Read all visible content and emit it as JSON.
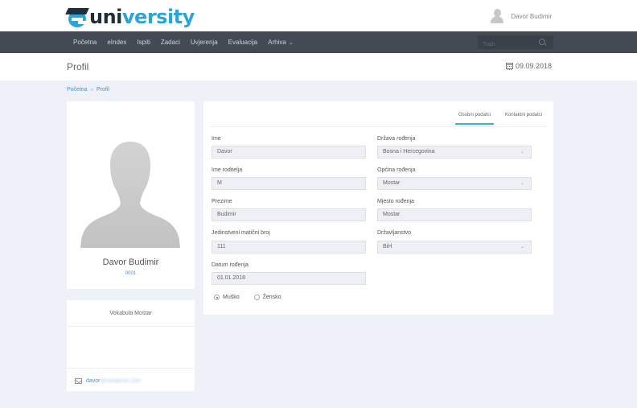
{
  "header": {
    "logo": {
      "part1": "uni",
      "part2": "versity"
    },
    "user_name": "Davor Budimir"
  },
  "nav": {
    "items": [
      "Početna",
      "eIndex",
      "Ispiti",
      "Zadaci",
      "Uvjerenja",
      "Evaluacija",
      "Arhiva"
    ],
    "search_placeholder": "Traži"
  },
  "page": {
    "title": "Profil",
    "date": "09.09.2018"
  },
  "breadcrumb": {
    "home": "Početna",
    "sep": "»",
    "current": "Profil"
  },
  "profile": {
    "name": "Davor Budimir",
    "id": "0001",
    "organization": "Vokabula Mostar",
    "email_prefix": "davor",
    "email_hidden": "@vokabula.com"
  },
  "tabs": {
    "personal": "Osobni podatci",
    "contact": "Kontaktni podatci"
  },
  "form": {
    "ime": {
      "label": "Ime",
      "value": "Davor"
    },
    "ime_roditelja": {
      "label": "Ime roditelja",
      "value": "M"
    },
    "prezime": {
      "label": "Prezime",
      "value": "Budimir"
    },
    "jmbg": {
      "label": "Jedinstveni matični broj",
      "value": "111"
    },
    "datum_rodjenja": {
      "label": "Datum rođenja",
      "value": "01.01.2018"
    },
    "drzava_rodjenja": {
      "label": "Država rođenja",
      "value": "Bosna i Hercegovina"
    },
    "opcina_rodjenja": {
      "label": "Općina rođenja",
      "value": "Mostar"
    },
    "mjesto_rodjenja": {
      "label": "Mjesto rođenja",
      "value": "Mostar"
    },
    "drzavljanstvo": {
      "label": "Državljanstvo",
      "value": "BiH"
    },
    "gender": {
      "male": "Muško",
      "female": "Žensko",
      "selected": "male"
    }
  },
  "colors": {
    "accent": "#2ea3d6",
    "nav_bg": "#434a54",
    "page_bg": "#eef1f8",
    "link": "#4a90c8"
  }
}
